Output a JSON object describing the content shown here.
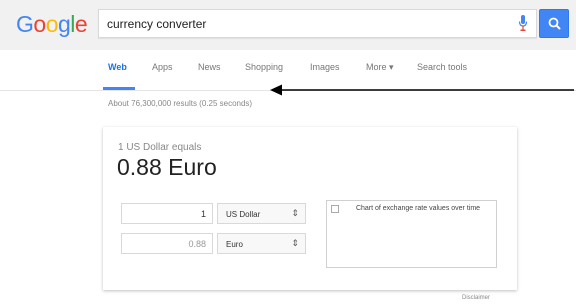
{
  "logo": {
    "text": "Google",
    "letters": [
      "G",
      "o",
      "o",
      "g",
      "l",
      "e"
    ],
    "colors": [
      "#4285f4",
      "#ea4335",
      "#fbbc05",
      "#4285f4",
      "#34a853",
      "#ea4335"
    ]
  },
  "search": {
    "query": "currency converter",
    "mic_icon": "mic-icon",
    "search_icon": "magnifier-icon",
    "accent": "#4285f4"
  },
  "tabs": [
    {
      "label": "Web",
      "active": true
    },
    {
      "label": "Apps"
    },
    {
      "label": "News"
    },
    {
      "label": "Shopping"
    },
    {
      "label": "Images"
    },
    {
      "label": "More ▾"
    },
    {
      "label": "Search tools"
    }
  ],
  "results": {
    "count_text": "About 76,300,000 results (0.25 seconds)"
  },
  "converter": {
    "equals_label": "1 US Dollar equals",
    "result": "0.88 Euro",
    "from_amount": "1",
    "from_unit": "US Dollar",
    "to_amount": "0.88",
    "to_unit": "Euro",
    "select_icon": "up-down-chevron-icon",
    "chart_alt": "Chart of exchange rate values over time"
  },
  "disclaimer": "Disclaimer"
}
